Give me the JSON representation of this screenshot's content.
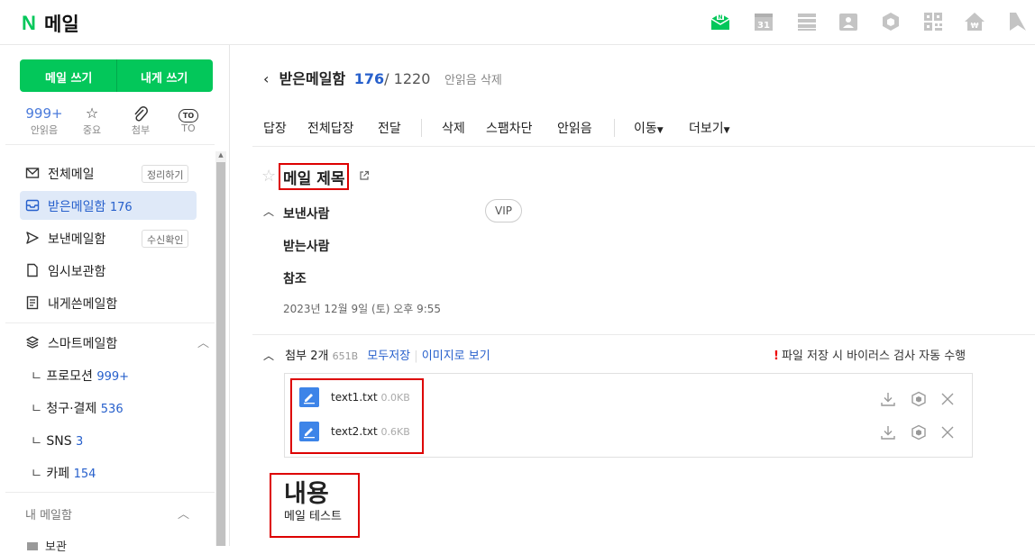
{
  "app": {
    "logo": "N",
    "title": "메일"
  },
  "topbar_icons": [
    "mail-inbox-icon",
    "calendar-icon",
    "list-icon",
    "contacts-icon",
    "cube-icon",
    "qr-icon",
    "pay-icon",
    "bookmark-icon"
  ],
  "calendar_day": "31",
  "sidebar": {
    "write": "메일 쓰기",
    "write_self": "내게 쓰기",
    "quick": [
      {
        "value": "999+",
        "label": "안읽음"
      },
      {
        "label": "중요"
      },
      {
        "label": "첨부"
      },
      {
        "badge": "TO",
        "label": "TO"
      }
    ],
    "folders": [
      {
        "label": "전체메일",
        "action": "정리하기"
      },
      {
        "label": "받은메일함",
        "count": "176"
      },
      {
        "label": "보낸메일함",
        "action": "수신확인"
      },
      {
        "label": "임시보관함"
      },
      {
        "label": "내게쓴메일함"
      }
    ],
    "smart": {
      "label": "스마트메일함"
    },
    "smart_items": [
      {
        "label": "프로모션",
        "count": "999+"
      },
      {
        "label": "청구·결제",
        "count": "536"
      },
      {
        "label": "SNS",
        "count": "3"
      },
      {
        "label": "카페",
        "count": "154"
      }
    ],
    "mine": {
      "label": "내 메일함"
    },
    "partial": "보관"
  },
  "main": {
    "folder": "받은메일함",
    "unread": "176",
    "total": "/ 1220",
    "delete_unread": "안읽음 삭제",
    "toolbar": [
      "답장",
      "전체답장",
      "전달",
      "삭제",
      "스팸차단",
      "안읽음",
      "이동",
      "더보기"
    ],
    "subject": "메일 제목",
    "sender_label": "보낸사람",
    "vip": "VIP",
    "recipient_label": "받는사람",
    "cc_label": "참조",
    "date": "2023년 12월 9일 (토) 오후 9:55",
    "attach": {
      "label": "첨부",
      "count": "2개",
      "size": "651B",
      "save_all": "모두저장",
      "view_image": "이미지로 보기",
      "warning_mark": "!",
      "warning": "파일 저장 시 바이러스 검사 자동 수행",
      "files": [
        {
          "name": "text1.txt",
          "size": "0.0KB"
        },
        {
          "name": "text2.txt",
          "size": "0.6KB"
        }
      ]
    },
    "body_heading": "내용",
    "body_text": "메일 테스트"
  }
}
